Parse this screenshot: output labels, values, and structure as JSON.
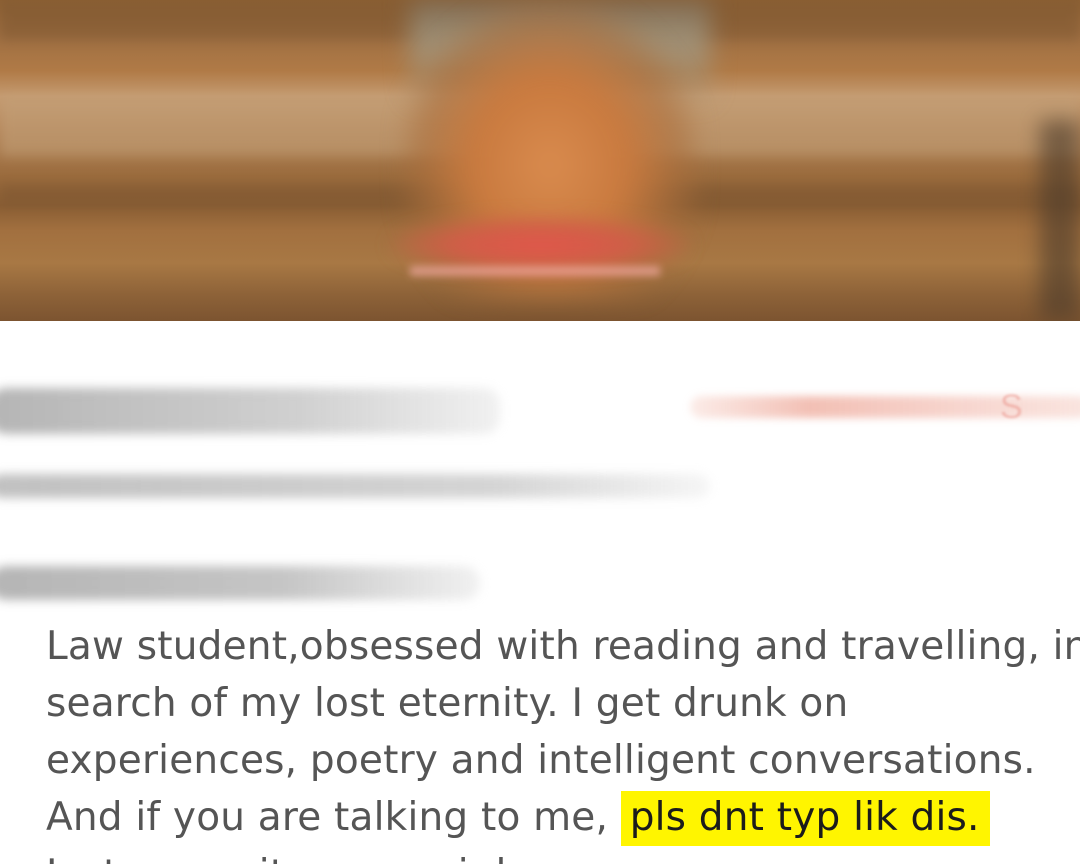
{
  "cover": {
    "image_label": "cover-photo"
  },
  "header": {
    "follow_button_label_fragment": "S"
  },
  "bio": {
    "line1": "Law student,obsessed with reading and travelling, in",
    "line2": "search of my lost eternity. I get drunk on",
    "line3": "experiences, poetry and intelligent conversations.",
    "line4_prefix": "And if you are talking to me, ",
    "line4_highlight": "pls dnt typ lik dis.",
    "line5_partial": "Instagram it me, anyi d"
  },
  "colors": {
    "highlight": "#fff500",
    "bio_text": "#555555",
    "accent": "#e8907e"
  }
}
